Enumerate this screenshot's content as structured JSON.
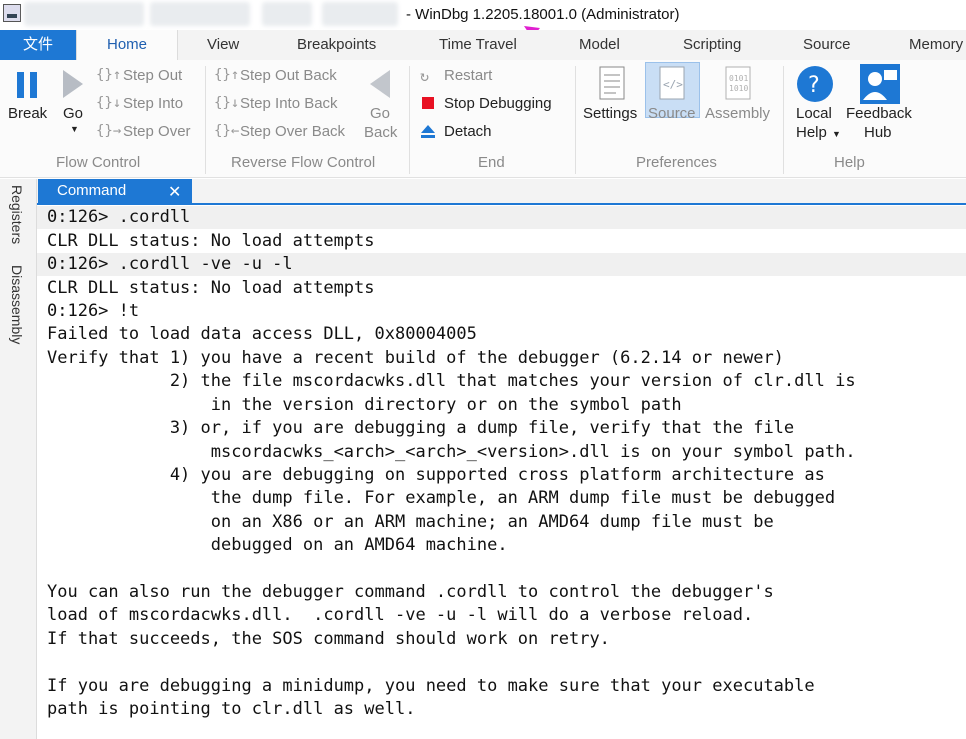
{
  "titlebar": {
    "title": "- WinDbg 1.2205.18001.0 (Administrator)"
  },
  "tabs": [
    {
      "label": "文件"
    },
    {
      "label": "Home"
    },
    {
      "label": "View"
    },
    {
      "label": "Breakpoints"
    },
    {
      "label": "Time Travel"
    },
    {
      "label": "Model"
    },
    {
      "label": "Scripting"
    },
    {
      "label": "Source"
    },
    {
      "label": "Memory"
    }
  ],
  "ribbon": {
    "flow": {
      "break": "Break",
      "go": "Go",
      "step_out": "Step Out",
      "step_into": "Step Into",
      "step_over": "Step Over",
      "group": "Flow Control"
    },
    "reverse": {
      "step_out_back": "Step Out Back",
      "step_into_back": "Step Into Back",
      "step_over_back": "Step Over Back",
      "go": "Go",
      "back": "Back",
      "group": "Reverse Flow Control"
    },
    "end": {
      "restart": "Restart",
      "stop": "Stop Debugging",
      "detach": "Detach",
      "group": "End"
    },
    "preferences": {
      "settings": "Settings",
      "source": "Source",
      "assembly": "Assembly",
      "group": "Preferences"
    },
    "help": {
      "local": "Local",
      "help": "Help",
      "feedback": "Feedback",
      "hub": "Hub",
      "group": "Help"
    }
  },
  "sidepanel": {
    "registers": "Registers",
    "disassembly": "Disassembly"
  },
  "command": {
    "title": "Command",
    "close": "✕",
    "lines": [
      "0:126> .cordll",
      "CLR DLL status: No load attempts",
      "0:126> .cordll -ve -u -l",
      "CLR DLL status: No load attempts",
      "0:126> !t",
      "Failed to load data access DLL, 0x80004005",
      "Verify that 1) you have a recent build of the debugger (6.2.14 or newer)",
      "            2) the file mscordacwks.dll that matches your version of clr.dll is",
      "                in the version directory or on the symbol path",
      "            3) or, if you are debugging a dump file, verify that the file",
      "                mscordacwks_<arch>_<arch>_<version>.dll is on your symbol path.",
      "            4) you are debugging on supported cross platform architecture as",
      "                the dump file. For example, an ARM dump file must be debugged",
      "                on an X86 or an ARM machine; an AMD64 dump file must be",
      "                debugged on an AMD64 machine.",
      "",
      "You can also run the debugger command .cordll to control the debugger's",
      "load of mscordacwks.dll.  .cordll -ve -u -l will do a verbose reload.",
      "If that succeeds, the SOS command should work on retry.",
      "",
      "If you are debugging a minidump, you need to make sure that your executable",
      "path is pointing to clr.dll as well."
    ]
  },
  "colors": {
    "accent": "#1e78d4",
    "stop": "#e81123",
    "annotation_arrow": "#e020d0"
  }
}
